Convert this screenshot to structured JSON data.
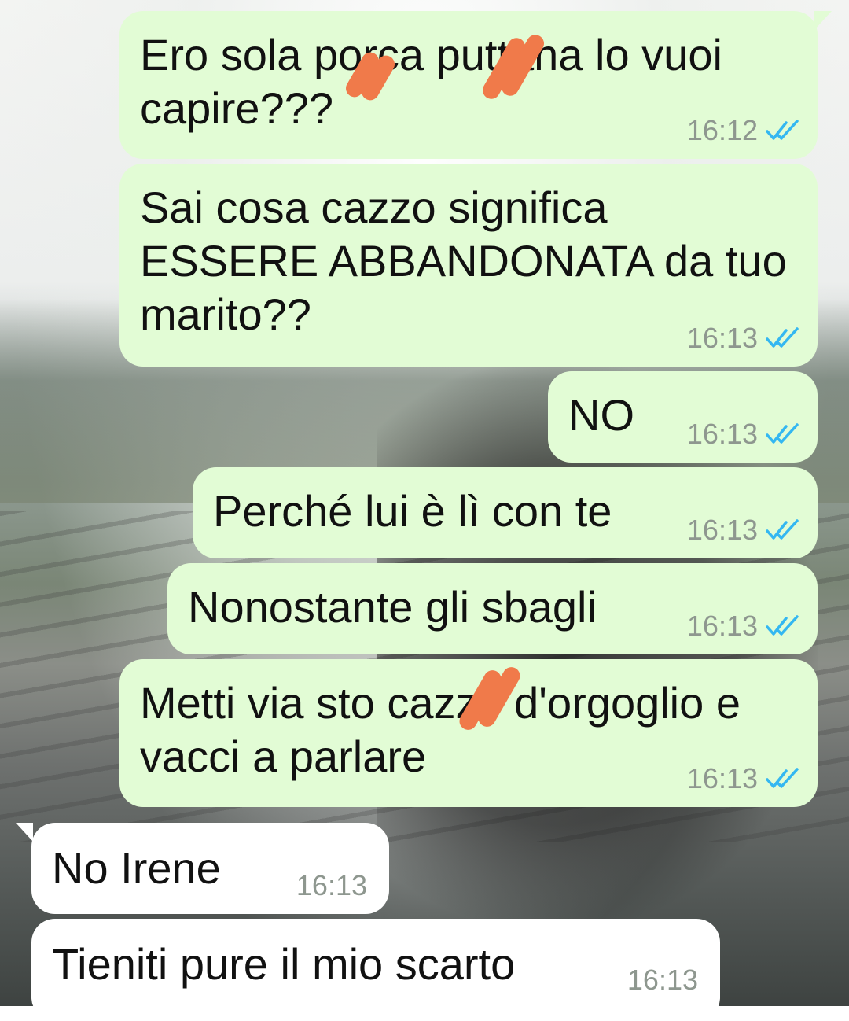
{
  "colors": {
    "outgoing_bubble": "#e2fcd5",
    "incoming_bubble": "#ffffff",
    "timestamp": "#8e978f",
    "read_ticks": "#34b7f1",
    "censor_marks": "#f07a4a"
  },
  "messages": [
    {
      "direction": "outgoing",
      "text": "Ero sola porca puttana lo vuoi\ncapire???",
      "time": "16:12",
      "status": "read-ticks-icon"
    },
    {
      "direction": "outgoing",
      "text": "Sai cosa cazzo significa\nESSERE ABBANDONATA da tuo\nmarito??",
      "time": "16:13",
      "status": "read-ticks-icon"
    },
    {
      "direction": "outgoing",
      "text": "NO",
      "time": "16:13",
      "status": "read-ticks-icon"
    },
    {
      "direction": "outgoing",
      "text": "Perché lui è lì con te",
      "time": "16:13",
      "status": "read-ticks-icon"
    },
    {
      "direction": "outgoing",
      "text": "Nonostante gli sbagli",
      "time": "16:13",
      "status": "read-ticks-icon"
    },
    {
      "direction": "outgoing",
      "text": "Metti via sto cazzo d'orgoglio e\nvacci a parlare",
      "time": "16:13",
      "status": "read-ticks-icon"
    },
    {
      "direction": "incoming",
      "text": "No Irene",
      "time": "16:13"
    },
    {
      "direction": "incoming",
      "text": "Tieniti pure il mio scarto",
      "time": "16:13"
    }
  ]
}
